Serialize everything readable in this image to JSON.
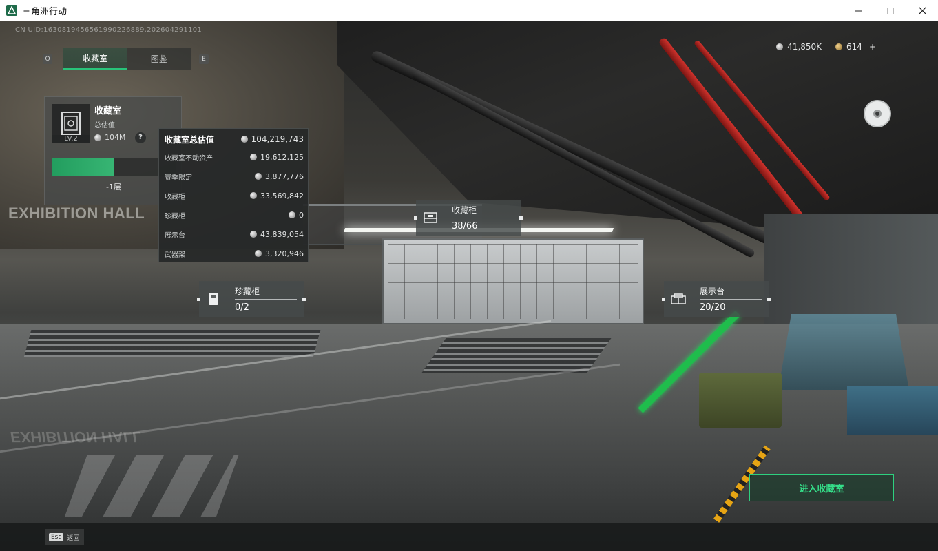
{
  "window": {
    "title": "三角洲行动",
    "min_icon": "minimize-icon",
    "max_icon": "maximize-icon",
    "close_icon": "close-icon"
  },
  "uid": "CN UID:1630819456561990226889,202604291101",
  "tabs": {
    "prev_key": "Q",
    "next_key": "E",
    "items": [
      {
        "label": "收藏室",
        "active": true
      },
      {
        "label": "图鉴",
        "active": false
      }
    ]
  },
  "currency": {
    "silver": "41,850K",
    "gold": "614",
    "add": "+"
  },
  "scene_text": {
    "sign": "EXHIBITION HALL",
    "sign_reflection": "EXHIBITION HALL"
  },
  "collection": {
    "title": "收藏室",
    "sub": "总估值",
    "value": "104M",
    "level": "LV.2",
    "help": "?",
    "floor": "-1层",
    "progress": 0.5
  },
  "breakdown": {
    "header_label": "收藏室总估值",
    "header_value": "104,219,743",
    "rows": [
      {
        "label": "收藏室不动资产",
        "value": "19,612,125"
      },
      {
        "label": "赛季限定",
        "value": "3,877,776"
      },
      {
        "label": "收藏柜",
        "value": "33,569,842"
      },
      {
        "label": "珍藏柜",
        "value": "0"
      },
      {
        "label": "展示台",
        "value": "43,839,054"
      },
      {
        "label": "武器架",
        "value": "3,320,946"
      }
    ]
  },
  "tags": {
    "cabinet": {
      "name": "收藏柜",
      "count": "38/66",
      "icon": "cabinet-icon"
    },
    "treasure": {
      "name": "珍藏柜",
      "count": "0/2",
      "icon": "safe-icon"
    },
    "display": {
      "name": "展示台",
      "count": "20/20",
      "icon": "display-stand-icon"
    }
  },
  "enter_button": "进入收藏室",
  "esc": {
    "key": "Esc",
    "label": "返回"
  },
  "colors": {
    "accent_green": "#28c47a",
    "button_green": "#35e08a"
  }
}
